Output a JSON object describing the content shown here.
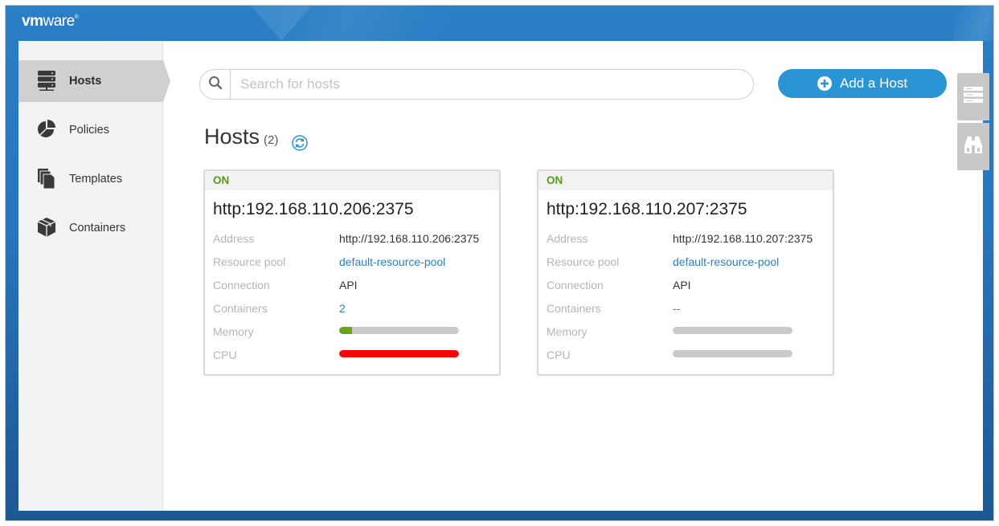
{
  "brand": {
    "logo_vm": "vm",
    "logo_ware": "ware"
  },
  "colors": {
    "accent": "#2b94d4",
    "status_on": "#5a9a1e",
    "memory_fill": "#6aa31e",
    "cpu_fill": "#ff0000",
    "link": "#2d7fbc"
  },
  "sidebar": {
    "items": [
      {
        "label": "Hosts",
        "icon": "server-stack-icon",
        "active": true
      },
      {
        "label": "Policies",
        "icon": "pie-chart-icon",
        "active": false
      },
      {
        "label": "Templates",
        "icon": "documents-icon",
        "active": false
      },
      {
        "label": "Containers",
        "icon": "package-icon",
        "active": false
      }
    ]
  },
  "search": {
    "placeholder": "Search for hosts",
    "value": ""
  },
  "toolbar": {
    "add_host_label": "Add a Host"
  },
  "side_tools": [
    {
      "icon": "server-rack-icon"
    },
    {
      "icon": "binoculars-icon"
    }
  ],
  "main": {
    "title": "Hosts",
    "count": "(2)",
    "hosts": [
      {
        "status": "ON",
        "name": "http:192.168.110.206:2375",
        "address_label": "Address",
        "address": "http://192.168.110.206:2375",
        "pool_label": "Resource pool",
        "pool": "default-resource-pool",
        "connection_label": "Connection",
        "connection": "API",
        "containers_label": "Containers",
        "containers": "2",
        "memory_label": "Memory",
        "memory_fraction": 0.11,
        "cpu_label": "CPU",
        "cpu_fraction": 1.0
      },
      {
        "status": "ON",
        "name": "http:192.168.110.207:2375",
        "address_label": "Address",
        "address": "http://192.168.110.207:2375",
        "pool_label": "Resource pool",
        "pool": "default-resource-pool",
        "connection_label": "Connection",
        "connection": "API",
        "containers_label": "Containers",
        "containers": "--",
        "memory_label": "Memory",
        "memory_fraction": 0,
        "cpu_label": "CPU",
        "cpu_fraction": 0
      }
    ]
  }
}
